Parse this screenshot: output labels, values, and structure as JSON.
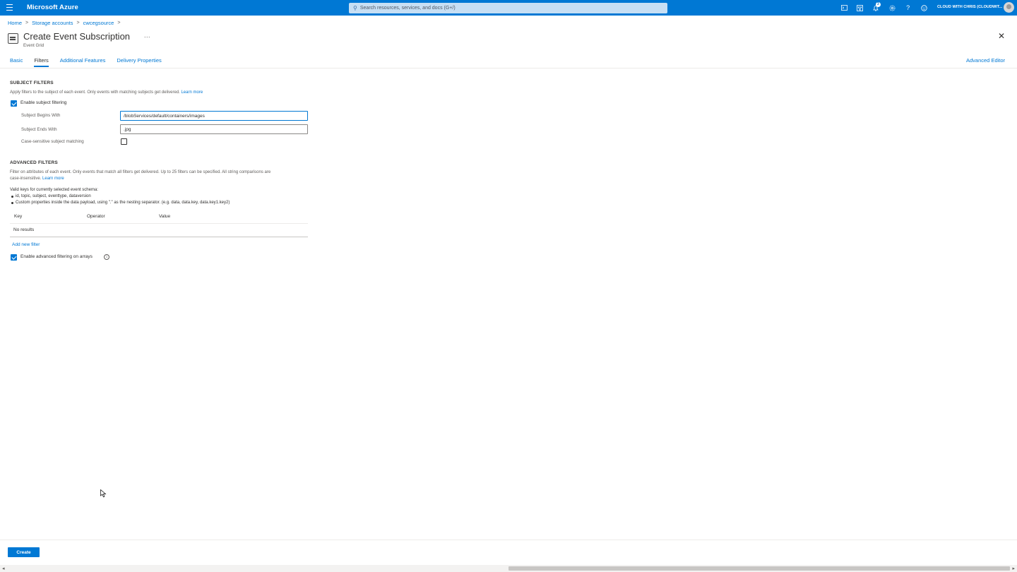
{
  "topbar": {
    "brand": "Microsoft Azure",
    "search_placeholder": "Search resources, services, and docs (G+/)",
    "notification_count": "3",
    "account": "CLOUD WITH CHRIS (CLOUDWIT...",
    "icons": [
      "terminal-icon",
      "directory-filter-icon",
      "bell-icon",
      "gear-icon",
      "help-icon",
      "feedback-icon"
    ]
  },
  "breadcrumb": [
    "Home",
    "Storage accounts",
    "cwcegsource"
  ],
  "header": {
    "title": "Create Event Subscription",
    "more": "...",
    "subtitle": "Event Grid"
  },
  "tabs": [
    {
      "label": "Basic",
      "active": false
    },
    {
      "label": "Filters",
      "active": true
    },
    {
      "label": "Additional Features",
      "active": false
    },
    {
      "label": "Delivery Properties",
      "active": false
    }
  ],
  "advanced_editor": "Advanced Editor",
  "subject_filters": {
    "title": "SUBJECT FILTERS",
    "description": "Apply filters to the subject of each event. Only events with matching subjects get delivered.",
    "learn_more": "Learn more",
    "enable_label": "Enable subject filtering",
    "enable_checked": true,
    "begins_with_label": "Subject Begins With",
    "begins_with_value": "/blobServices/default/containers/images",
    "ends_with_label": "Subject Ends With",
    "ends_with_value": ".jpg",
    "case_sensitive_label": "Case-sensitive subject matching",
    "case_sensitive_checked": false
  },
  "advanced_filters": {
    "title": "ADVANCED FILTERS",
    "description_line1": "Filter on attributes of each event. Only events that match all filters get delivered. Up to 25 filters can be specified. All string comparisons are",
    "description_line2": "case-insensitive.",
    "learn_more": "Learn more",
    "valid_keys_heading": "Valid keys for currently selected event schema:",
    "valid_keys": [
      "id, topic, subject, eventtype, dataversion",
      "Custom properties inside the data payload, using \".\" as the nesting separator. (e.g. data, data.key, data.key1.key2)"
    ],
    "table_headers": [
      "Key",
      "Operator",
      "Value"
    ],
    "empty_text": "No results",
    "add_filter": "Add new filter",
    "arrays_label": "Enable advanced filtering on arrays",
    "arrays_checked": true,
    "info_glyph": "i"
  },
  "footer": {
    "create_label": "Create"
  },
  "scrollbar": {
    "left_arrow": "◂",
    "right_arrow": "▸"
  },
  "colors": {
    "accent": "#0078d4",
    "text": "#323130",
    "muted": "#605e5c"
  }
}
